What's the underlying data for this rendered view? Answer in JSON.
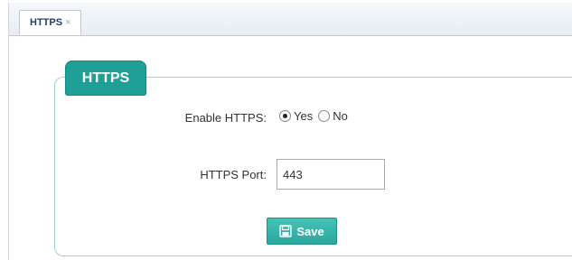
{
  "tab": {
    "label": "HTTPS",
    "close_glyph": "×"
  },
  "section": {
    "title": "HTTPS"
  },
  "form": {
    "enable_label": "Enable HTTPS:",
    "enable_options": [
      {
        "label": "Yes",
        "selected": true
      },
      {
        "label": "No",
        "selected": false
      }
    ],
    "port_label": "HTTPS Port:",
    "port_value": "443"
  },
  "actions": {
    "save_label": "Save",
    "save_icon": "floppy-disk-icon"
  },
  "colors": {
    "accent": "#1f9f96",
    "border": "#9fd3cf"
  }
}
